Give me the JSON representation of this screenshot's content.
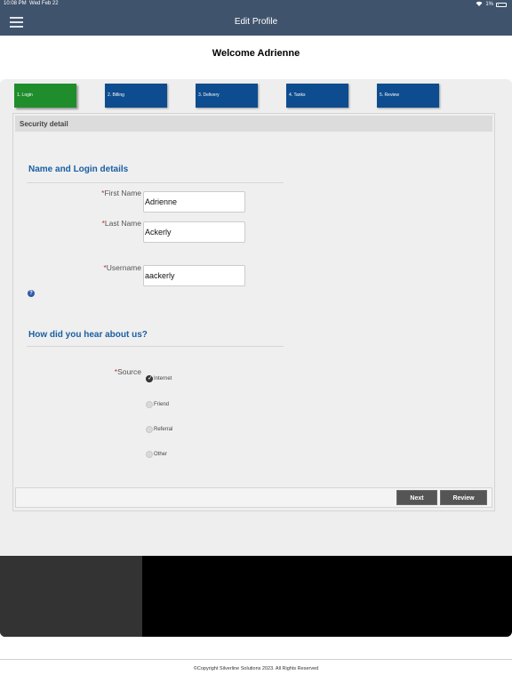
{
  "status_bar": {
    "time": "10:08 PM",
    "date": "Wed Feb 22",
    "battery": "1%"
  },
  "nav": {
    "title": "Edit Profile",
    "menu_icon": "hamburger-icon"
  },
  "welcome": "Welcome Adrienne",
  "steps": [
    {
      "label": "1. Login",
      "active": true
    },
    {
      "label": "2. Billing",
      "active": false
    },
    {
      "label": "3. Delivery",
      "active": false
    },
    {
      "label": "4. Tanks",
      "active": false
    },
    {
      "label": "5. Review",
      "active": false
    }
  ],
  "section_title": "Security detail",
  "login": {
    "heading": "Name and Login details",
    "required_mark": "*",
    "first_name": {
      "label": "First Name",
      "value": "Adrienne"
    },
    "last_name": {
      "label": "Last Name",
      "value": "Ackerly"
    },
    "username": {
      "label": "Username",
      "value": "aackerly"
    },
    "help_icon": "question-circle-icon",
    "help_glyph": "?"
  },
  "source": {
    "heading": "How did you hear about us?",
    "label": "Source",
    "options": [
      {
        "label": "Internet",
        "checked": true
      },
      {
        "label": "Friend",
        "checked": false
      },
      {
        "label": "Referral",
        "checked": false
      },
      {
        "label": "Other",
        "checked": false
      }
    ]
  },
  "buttons": {
    "next": "Next",
    "review": "Review"
  },
  "footer": {
    "copyright": "©Copyright Silverline Solutions 2023. All Rights Reserved"
  },
  "colors": {
    "nav_bg": "#3f536c",
    "step_active": "#1f8d2c",
    "step_inactive": "#0d4c8f",
    "heading_blue": "#1a5fa3",
    "required_red": "#cc2b2b",
    "button_gray": "#555555"
  }
}
